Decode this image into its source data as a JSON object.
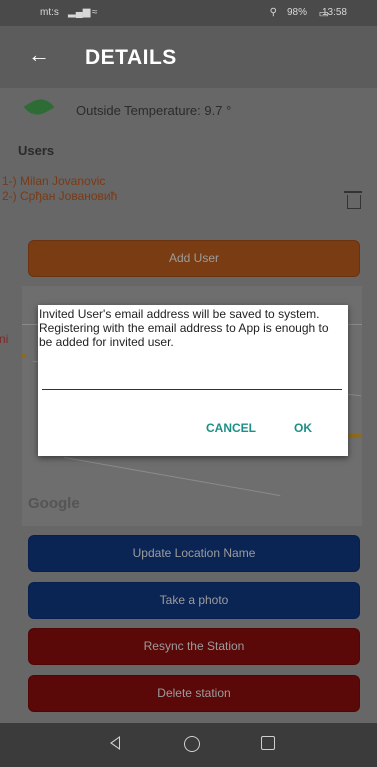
{
  "status": {
    "carrier": "mt:s",
    "signal_icon": "signal-bars-icon",
    "wifi_icon": "wifi-icon",
    "battery": "98%",
    "time": "13:58"
  },
  "appbar": {
    "back_icon": "arrow-left-icon",
    "title": "DETAILS"
  },
  "temperature": {
    "icon": "leaf-icon",
    "text": "Outside Temperature: 9.7 °"
  },
  "users": {
    "label": "Users",
    "items": [
      {
        "text": "1-) Milan Jovanovic"
      },
      {
        "text": "2-) Срђан Јовановић"
      }
    ],
    "delete_icon": "trash-icon"
  },
  "buttons": {
    "add_user": "Add User",
    "update_location": "Update Location Name",
    "take_photo": "Take a photo",
    "resync": "Resync the Station",
    "delete_station": "Delete station"
  },
  "map": {
    "provider": "Google"
  },
  "dialog": {
    "message": "Invited User's email address will be saved to system. Registering with the email address to App is enough to be added for invited user.",
    "input_value": "",
    "cancel": "CANCEL",
    "ok": "OK"
  },
  "navbar": {
    "back_icon": "triangle-back-icon",
    "home_icon": "circle-home-icon",
    "recent_icon": "square-recent-icon"
  },
  "colors": {
    "orange": "#7a3d13",
    "blue": "#0a2454",
    "red": "#5a0808",
    "dialog_action": "#1e8f87",
    "user_text": "#7a3a16"
  }
}
